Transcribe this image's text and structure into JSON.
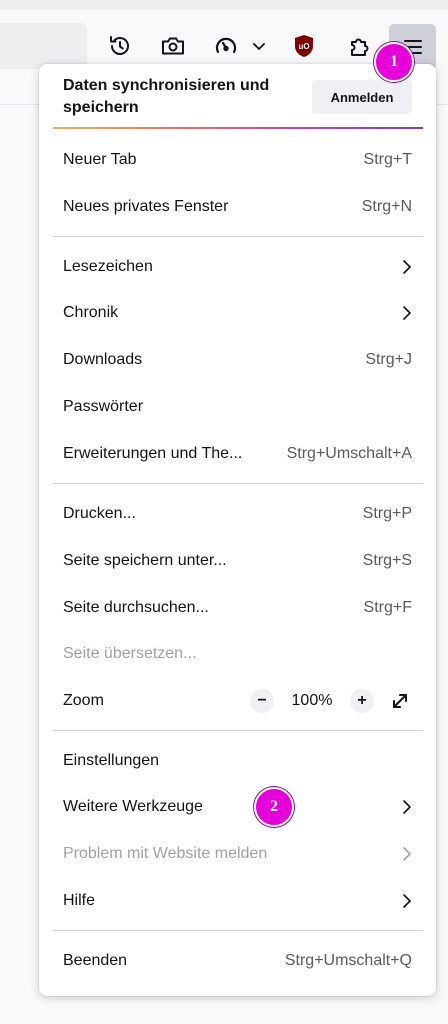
{
  "toolbar": {
    "icons": [
      "history-icon",
      "camera-icon",
      "speedometer-icon",
      "chevron-down-icon",
      "ublock-shield-icon",
      "puzzle-icon",
      "hamburger-menu-icon"
    ],
    "badge_1": "1"
  },
  "menu": {
    "sync_title": "Daten synchronisieren und speichern",
    "signin_label": "Anmelden",
    "items": [
      {
        "label": "Neuer Tab",
        "shortcut": "Strg+T"
      },
      {
        "label": "Neues privates Fenster",
        "shortcut": "Strg+N"
      },
      {
        "label": "Lesezeichen"
      },
      {
        "label": "Chronik"
      },
      {
        "label": "Downloads",
        "shortcut": "Strg+J"
      },
      {
        "label": "Passwörter"
      },
      {
        "label": "Erweiterungen und The...",
        "shortcut": "Strg+Umschalt+A"
      },
      {
        "label": "Drucken...",
        "shortcut": "Strg+P"
      },
      {
        "label": "Seite speichern unter...",
        "shortcut": "Strg+S"
      },
      {
        "label": "Seite durchsuchen...",
        "shortcut": "Strg+F"
      },
      {
        "label": "Seite übersetzen...",
        "disabled": true
      },
      {
        "label": "Zoom",
        "minus": "−",
        "value": "100%",
        "plus": "+"
      },
      {
        "label": "Einstellungen"
      },
      {
        "label": "Weitere Werkzeuge"
      },
      {
        "label": "Problem mit Website melden",
        "disabled": true
      },
      {
        "label": "Hilfe"
      },
      {
        "label": "Beenden",
        "shortcut": "Strg+Umschalt+Q"
      }
    ],
    "badge_2": "2"
  },
  "colors": {
    "badge": "#e500d9",
    "menu_button_active": "#cfcfd8",
    "disabled_text": "#a2a2a8"
  }
}
